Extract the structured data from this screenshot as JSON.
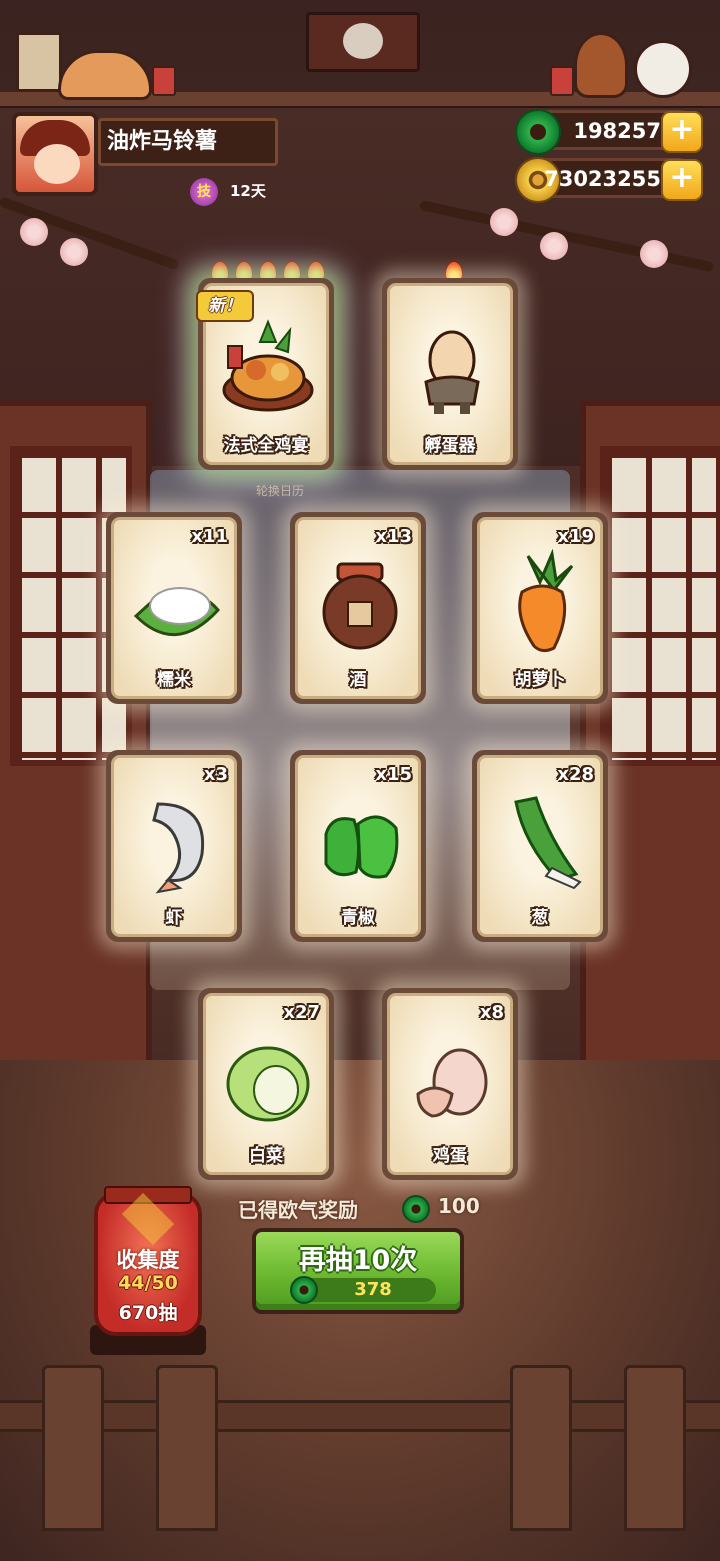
{
  "player": {
    "name": "油炸马铃薯",
    "skill_badge": "技",
    "skill_days": "12天"
  },
  "currency": {
    "jade": "198257",
    "gold": "73023255"
  },
  "featured": [
    {
      "name": "法式全鸡宴",
      "flames": 5,
      "tag": "新！",
      "is_new": true
    },
    {
      "name": "孵蛋器",
      "flames": 1
    }
  ],
  "rotate_label": "轮换日历",
  "ingredients": [
    {
      "name": "糯米",
      "qty": "x11"
    },
    {
      "name": "酒",
      "qty": "x13"
    },
    {
      "name": "胡萝卜",
      "qty": "x19"
    },
    {
      "name": "虾",
      "qty": "x3"
    },
    {
      "name": "青椒",
      "qty": "x15"
    },
    {
      "name": "葱",
      "qty": "x28"
    },
    {
      "name": "白菜",
      "qty": "x27"
    },
    {
      "name": "鸡蛋",
      "qty": "x8"
    }
  ],
  "collection": {
    "title": "收集度",
    "progress": "44/50",
    "pulls": "670抽"
  },
  "reward": {
    "text": "已得欧气奖励",
    "value": "100"
  },
  "draw_button": {
    "label": "再抽10次",
    "cost": "378"
  },
  "colors": {
    "button_green": "#6fbb33",
    "lantern_red": "#c42c28",
    "jade_green": "#2db34a",
    "gold": "#f8cf4a"
  }
}
